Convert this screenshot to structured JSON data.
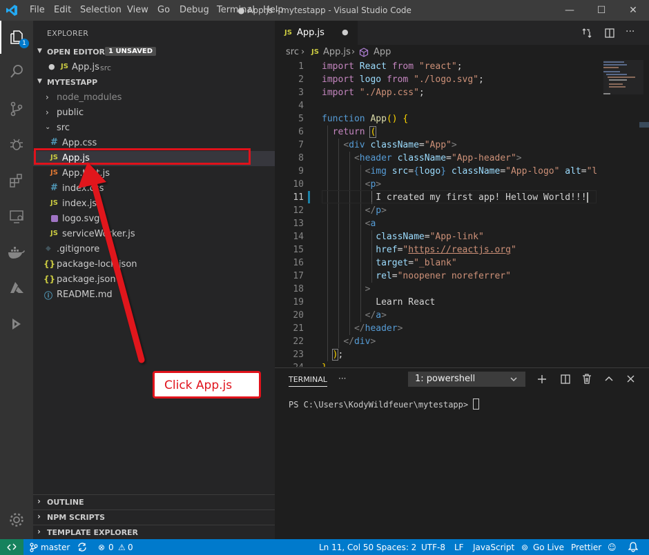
{
  "titlebar": {
    "menus": [
      "File",
      "Edit",
      "Selection",
      "View",
      "Go",
      "Debug",
      "Terminal",
      "Help"
    ],
    "window_title": "● App.js - mytestapp - Visual Studio Code",
    "minimize": "—",
    "maximize": "☐",
    "close": "✕"
  },
  "activitybar": {
    "explorer_badge": "1",
    "icons": [
      "files-icon",
      "search-icon",
      "source-control-icon",
      "debug-icon",
      "extensions-icon",
      "remote-explorer-icon",
      "docker-icon",
      "azure-icon",
      "deploy-icon",
      "settings-gear-icon"
    ]
  },
  "sidebar": {
    "title": "EXPLORER",
    "open_editors": {
      "label": "OPEN EDITORS",
      "badge": "1 UNSAVED",
      "file_label": "App.js",
      "file_dir": "src",
      "file_icon": "JS"
    },
    "project": {
      "label": "MYTESTAPP",
      "items": [
        {
          "label": "node_modules",
          "type": "folder"
        },
        {
          "label": "public",
          "type": "folder"
        },
        {
          "label": "src",
          "type": "folder-open"
        },
        {
          "label": "App.css",
          "type": "css",
          "icon": "#"
        },
        {
          "label": "App.js",
          "type": "js",
          "icon": "JS"
        },
        {
          "label": "App.test.js",
          "type": "js",
          "icon": "JS"
        },
        {
          "label": "index.css",
          "type": "css",
          "icon": "#"
        },
        {
          "label": "index.js",
          "type": "js",
          "icon": "JS"
        },
        {
          "label": "logo.svg",
          "type": "svg",
          "icon": ""
        },
        {
          "label": "serviceWorker.js",
          "type": "js",
          "icon": "JS"
        },
        {
          "label": ".gitignore",
          "type": "git",
          "icon": "◆"
        },
        {
          "label": "package-lock.json",
          "type": "json",
          "icon": "{}"
        },
        {
          "label": "package.json",
          "type": "json",
          "icon": "{}"
        },
        {
          "label": "README.md",
          "type": "md",
          "icon": "ⓘ"
        }
      ]
    },
    "bottom_sections": [
      "OUTLINE",
      "NPM SCRIPTS",
      "TEMPLATE EXPLORER"
    ]
  },
  "editor": {
    "tab_label": "App.js",
    "tab_icon": "JS",
    "tab_dirty": "●",
    "breadcrumb": [
      "src",
      "App.js",
      "App"
    ],
    "line_numbers": [
      "1",
      "2",
      "3",
      "4",
      "5",
      "6",
      "7",
      "8",
      "9",
      "10",
      "11",
      "12",
      "13",
      "14",
      "15",
      "16",
      "17",
      "18",
      "19",
      "20",
      "21",
      "22",
      "23",
      "24"
    ]
  },
  "panel": {
    "tab_label": "TERMINAL",
    "more": "···",
    "terminal_select": "1: powershell",
    "prompt": "PS C:\\Users\\KodyWildfeuer\\mytestapp> "
  },
  "statusbar": {
    "branch": "master",
    "errors": "0",
    "warnings": "0",
    "position": "Ln 11, Col 50",
    "spaces": "Spaces: 2",
    "encoding": "UTF-8",
    "eol": "LF",
    "language": "JavaScript",
    "golive": "Go Live",
    "prettier": "Prettier"
  },
  "annotation": {
    "callout_text": "Click App.js",
    "accent_color": "#e0121b"
  }
}
